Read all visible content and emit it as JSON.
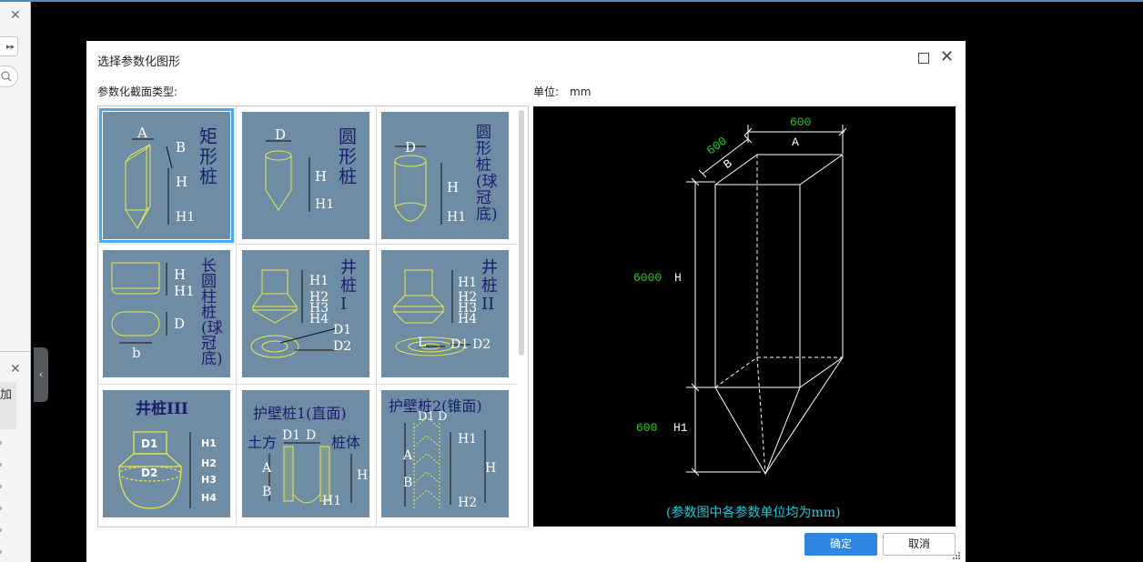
{
  "dialog": {
    "title": "选择参数化图形",
    "section_label": "参数化截面类型:",
    "unit_label": "单位:",
    "unit_value": "mm",
    "ok_label": "确定",
    "cancel_label": "取消"
  },
  "left_panel": {
    "close_glyph": "✕",
    "add_label": "加"
  },
  "shapes": [
    {
      "name": "矩形桩",
      "labels": [
        "A",
        "B",
        "H",
        "H1"
      ],
      "selected": true
    },
    {
      "name": "圆形桩",
      "labels": [
        "D",
        "H",
        "H1"
      ],
      "selected": false
    },
    {
      "name": "圆形桩(球冠底)",
      "labels": [
        "D",
        "H",
        "H1"
      ],
      "selected": false
    },
    {
      "name": "长圆柱桩(球冠底)",
      "labels": [
        "H",
        "H1",
        "D",
        "b"
      ],
      "selected": false
    },
    {
      "name": "井桩I",
      "labels": [
        "H1",
        "H2",
        "H3",
        "H4",
        "D1",
        "D2"
      ],
      "selected": false
    },
    {
      "name": "井桩II",
      "labels": [
        "H1",
        "H2",
        "H3",
        "H4",
        "L",
        "D1",
        "D2"
      ],
      "selected": false
    },
    {
      "name": "井桩III",
      "labels": [
        "D1",
        "D2",
        "H1",
        "H2",
        "H3",
        "H4"
      ],
      "selected": false
    },
    {
      "name": "护壁桩1(直面)",
      "labels": [
        "土方",
        "D1",
        "D",
        "桩体",
        "A",
        "B",
        "H",
        "H1"
      ],
      "selected": false
    },
    {
      "name": "护壁桩2(锥面)",
      "labels": [
        "D1",
        "D",
        "H1",
        "A",
        "B",
        "H",
        "H2"
      ],
      "selected": false
    }
  ],
  "preview": {
    "dims": {
      "A": {
        "label": "A",
        "value": "600"
      },
      "B": {
        "label": "B",
        "value": "600"
      },
      "H": {
        "label": "H",
        "value": "6000"
      },
      "H1": {
        "label": "H1",
        "value": "600"
      }
    },
    "note": "(参数图中各参数单位均为mm)"
  },
  "colors": {
    "accent": "#2f86e0",
    "tile_bg": "#6e8da4",
    "tile_selected_border": "#49a7f0",
    "drawing_yellow": "#e8e84a",
    "preview_dim_value": "#22cc22",
    "preview_note": "#22c8e0",
    "tile_text": "#1c1c6e"
  }
}
